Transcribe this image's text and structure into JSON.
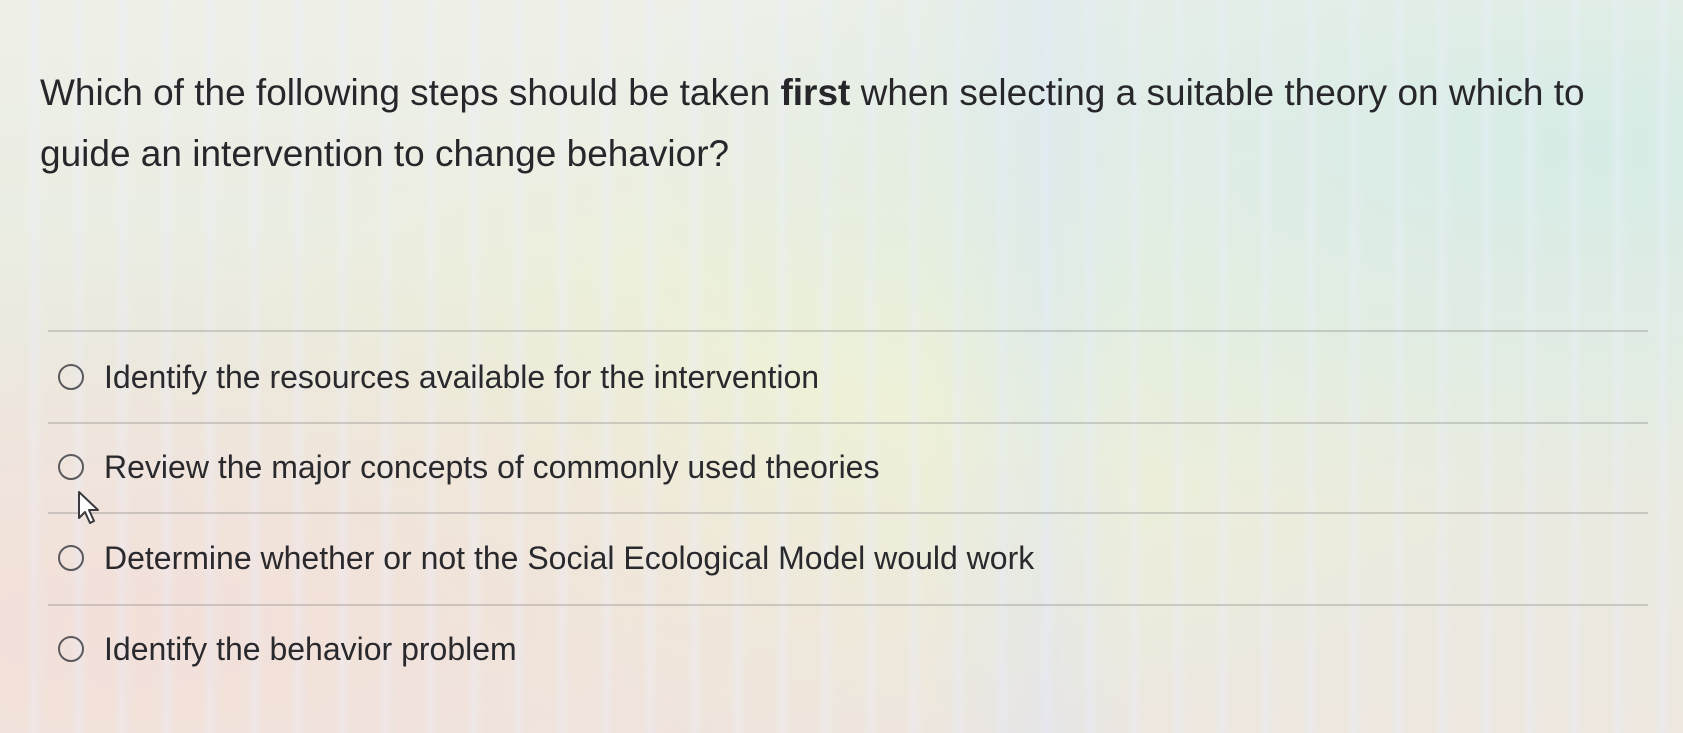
{
  "question": {
    "text_before": "Which of the following steps should be taken ",
    "emphasis": "first",
    "text_after": " when selecting a suitable theory on which to guide an intervention to change behavior?"
  },
  "options": [
    {
      "label": "Identify the resources available for the intervention",
      "selected": false
    },
    {
      "label": "Review the major concepts of commonly used theories",
      "selected": false
    },
    {
      "label": "Determine whether or not the Social Ecological Model would work",
      "selected": false
    },
    {
      "label": "Identify the behavior problem",
      "selected": false
    }
  ],
  "icons": {
    "radio": "radio-button-icon",
    "cursor": "mouse-pointer-icon"
  },
  "colors": {
    "text": "#27272b",
    "radio_border": "#5a5a5e",
    "divider": "#a0a0a0"
  }
}
